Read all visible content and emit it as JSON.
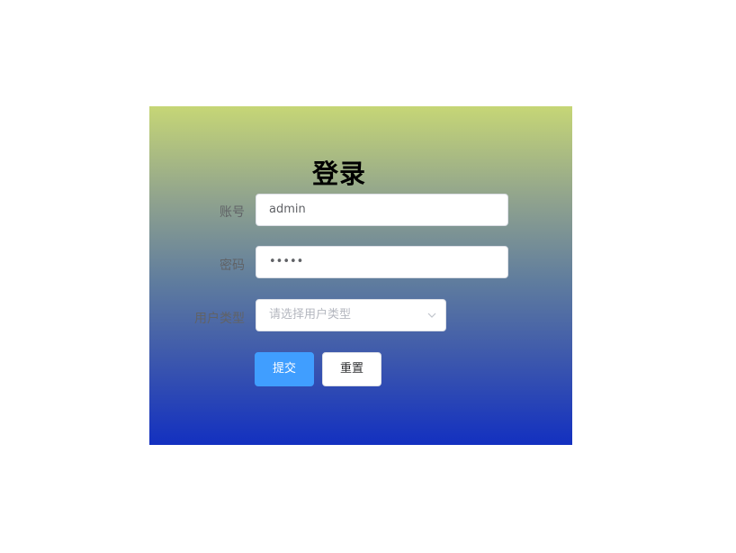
{
  "login": {
    "title": "登录",
    "account_label": "账号",
    "account_value": "admin",
    "password_label": "密码",
    "password_value": "•••••",
    "user_type_label": "用户类型",
    "user_type_placeholder": "请选择用户类型",
    "submit_label": "提交",
    "reset_label": "重置"
  },
  "colors": {
    "gradient_top": "#c6d676",
    "gradient_bottom": "#1330c0",
    "primary_button": "#409eff"
  },
  "icons": {
    "select_arrow": "chevron-down-icon"
  }
}
